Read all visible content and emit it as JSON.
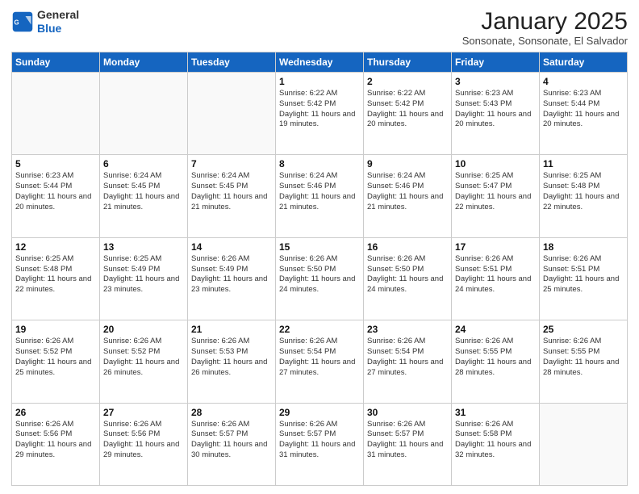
{
  "header": {
    "logo_line1": "General",
    "logo_line2": "Blue",
    "month_title": "January 2025",
    "location": "Sonsonate, Sonsonate, El Salvador"
  },
  "days_of_week": [
    "Sunday",
    "Monday",
    "Tuesday",
    "Wednesday",
    "Thursday",
    "Friday",
    "Saturday"
  ],
  "weeks": [
    [
      {
        "day": "",
        "detail": ""
      },
      {
        "day": "",
        "detail": ""
      },
      {
        "day": "",
        "detail": ""
      },
      {
        "day": "1",
        "detail": "Sunrise: 6:22 AM\nSunset: 5:42 PM\nDaylight: 11 hours and 19 minutes."
      },
      {
        "day": "2",
        "detail": "Sunrise: 6:22 AM\nSunset: 5:42 PM\nDaylight: 11 hours and 20 minutes."
      },
      {
        "day": "3",
        "detail": "Sunrise: 6:23 AM\nSunset: 5:43 PM\nDaylight: 11 hours and 20 minutes."
      },
      {
        "day": "4",
        "detail": "Sunrise: 6:23 AM\nSunset: 5:44 PM\nDaylight: 11 hours and 20 minutes."
      }
    ],
    [
      {
        "day": "5",
        "detail": "Sunrise: 6:23 AM\nSunset: 5:44 PM\nDaylight: 11 hours and 20 minutes."
      },
      {
        "day": "6",
        "detail": "Sunrise: 6:24 AM\nSunset: 5:45 PM\nDaylight: 11 hours and 21 minutes."
      },
      {
        "day": "7",
        "detail": "Sunrise: 6:24 AM\nSunset: 5:45 PM\nDaylight: 11 hours and 21 minutes."
      },
      {
        "day": "8",
        "detail": "Sunrise: 6:24 AM\nSunset: 5:46 PM\nDaylight: 11 hours and 21 minutes."
      },
      {
        "day": "9",
        "detail": "Sunrise: 6:24 AM\nSunset: 5:46 PM\nDaylight: 11 hours and 21 minutes."
      },
      {
        "day": "10",
        "detail": "Sunrise: 6:25 AM\nSunset: 5:47 PM\nDaylight: 11 hours and 22 minutes."
      },
      {
        "day": "11",
        "detail": "Sunrise: 6:25 AM\nSunset: 5:48 PM\nDaylight: 11 hours and 22 minutes."
      }
    ],
    [
      {
        "day": "12",
        "detail": "Sunrise: 6:25 AM\nSunset: 5:48 PM\nDaylight: 11 hours and 22 minutes."
      },
      {
        "day": "13",
        "detail": "Sunrise: 6:25 AM\nSunset: 5:49 PM\nDaylight: 11 hours and 23 minutes."
      },
      {
        "day": "14",
        "detail": "Sunrise: 6:26 AM\nSunset: 5:49 PM\nDaylight: 11 hours and 23 minutes."
      },
      {
        "day": "15",
        "detail": "Sunrise: 6:26 AM\nSunset: 5:50 PM\nDaylight: 11 hours and 24 minutes."
      },
      {
        "day": "16",
        "detail": "Sunrise: 6:26 AM\nSunset: 5:50 PM\nDaylight: 11 hours and 24 minutes."
      },
      {
        "day": "17",
        "detail": "Sunrise: 6:26 AM\nSunset: 5:51 PM\nDaylight: 11 hours and 24 minutes."
      },
      {
        "day": "18",
        "detail": "Sunrise: 6:26 AM\nSunset: 5:51 PM\nDaylight: 11 hours and 25 minutes."
      }
    ],
    [
      {
        "day": "19",
        "detail": "Sunrise: 6:26 AM\nSunset: 5:52 PM\nDaylight: 11 hours and 25 minutes."
      },
      {
        "day": "20",
        "detail": "Sunrise: 6:26 AM\nSunset: 5:52 PM\nDaylight: 11 hours and 26 minutes."
      },
      {
        "day": "21",
        "detail": "Sunrise: 6:26 AM\nSunset: 5:53 PM\nDaylight: 11 hours and 26 minutes."
      },
      {
        "day": "22",
        "detail": "Sunrise: 6:26 AM\nSunset: 5:54 PM\nDaylight: 11 hours and 27 minutes."
      },
      {
        "day": "23",
        "detail": "Sunrise: 6:26 AM\nSunset: 5:54 PM\nDaylight: 11 hours and 27 minutes."
      },
      {
        "day": "24",
        "detail": "Sunrise: 6:26 AM\nSunset: 5:55 PM\nDaylight: 11 hours and 28 minutes."
      },
      {
        "day": "25",
        "detail": "Sunrise: 6:26 AM\nSunset: 5:55 PM\nDaylight: 11 hours and 28 minutes."
      }
    ],
    [
      {
        "day": "26",
        "detail": "Sunrise: 6:26 AM\nSunset: 5:56 PM\nDaylight: 11 hours and 29 minutes."
      },
      {
        "day": "27",
        "detail": "Sunrise: 6:26 AM\nSunset: 5:56 PM\nDaylight: 11 hours and 29 minutes."
      },
      {
        "day": "28",
        "detail": "Sunrise: 6:26 AM\nSunset: 5:57 PM\nDaylight: 11 hours and 30 minutes."
      },
      {
        "day": "29",
        "detail": "Sunrise: 6:26 AM\nSunset: 5:57 PM\nDaylight: 11 hours and 31 minutes."
      },
      {
        "day": "30",
        "detail": "Sunrise: 6:26 AM\nSunset: 5:57 PM\nDaylight: 11 hours and 31 minutes."
      },
      {
        "day": "31",
        "detail": "Sunrise: 6:26 AM\nSunset: 5:58 PM\nDaylight: 11 hours and 32 minutes."
      },
      {
        "day": "",
        "detail": ""
      }
    ]
  ]
}
